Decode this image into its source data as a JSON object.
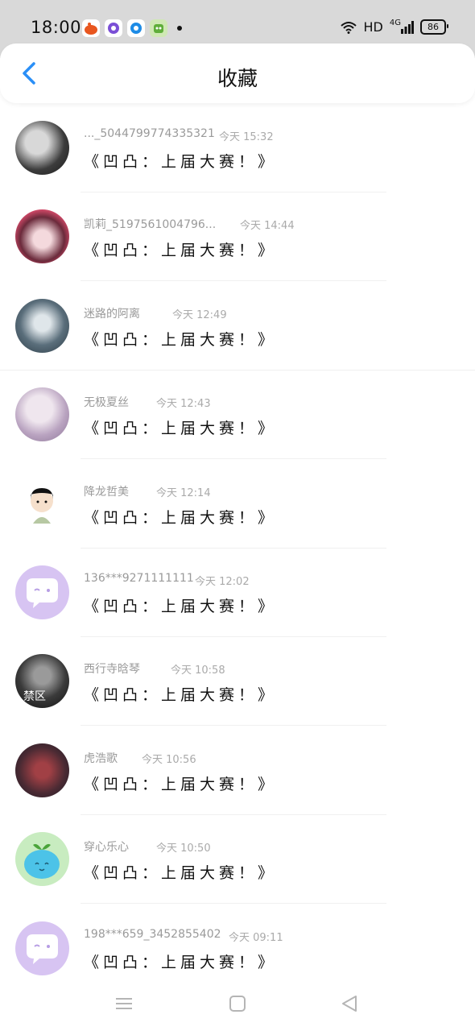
{
  "status_bar": {
    "time": "18:00",
    "network": "HD",
    "signal": "4G",
    "battery": "86"
  },
  "header": {
    "title": "收藏",
    "back_icon": "chevron-left-icon"
  },
  "colors": {
    "accent": "#2a8ff7",
    "purple_avatar": "#d7c4f2",
    "muted_text": "#9a9a9a"
  },
  "items": [
    {
      "name": "..._5044799774335321",
      "time": "今天 15:32",
      "message": "《凹凸：上届大赛！》"
    },
    {
      "name": "凯莉_5197561004796...",
      "time": "今天 14:44",
      "message": "《凹凸：上届大赛！》"
    },
    {
      "name": "迷路的阿离",
      "time": "今天 12:49",
      "message": "《凹凸：上届大赛！》"
    },
    {
      "name": "无极夏丝",
      "time": "今天 12:43",
      "message": "《凹凸：上届大赛！》"
    },
    {
      "name": "降龙哲美",
      "time": "今天 12:14",
      "message": "《凹凸：上届大赛！》"
    },
    {
      "name": "136***9271111111",
      "time": "今天 12:02",
      "message": "《凹凸：上届大赛！》"
    },
    {
      "name": "西行寺晗琴",
      "time": "今天 10:58",
      "message": "《凹凸：上届大赛！》",
      "avatar_text": "禁区"
    },
    {
      "name": "虎浩歌",
      "time": "今天 10:56",
      "message": "《凹凸：上届大赛！》"
    },
    {
      "name": "穿心乐心",
      "time": "今天 10:50",
      "message": "《凹凸：上届大赛！》"
    },
    {
      "name": "198***659_3452855402",
      "time": "今天 09:11",
      "message": "《凹凸：上届大赛！》"
    }
  ],
  "nav": {
    "menu_icon": "menu-icon",
    "home_icon": "square-icon",
    "back_icon": "triangle-back-icon"
  }
}
